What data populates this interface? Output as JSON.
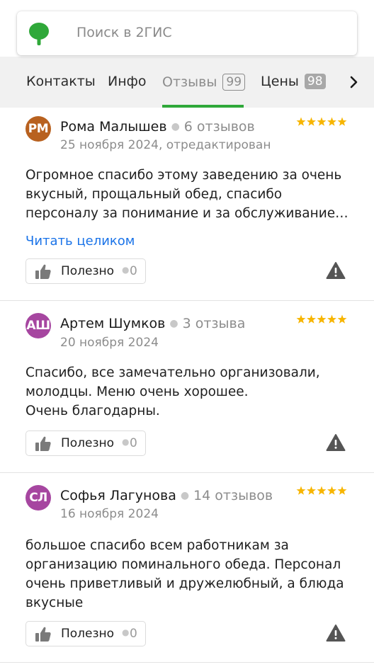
{
  "search": {
    "placeholder": "Поиск в 2ГИС",
    "logo_icon": "2gis-logo-icon",
    "brand_color": "#2fa839"
  },
  "tabs": [
    {
      "label": "Контакты"
    },
    {
      "label": "Инфо"
    },
    {
      "label": "Отзывы",
      "count": "99",
      "active": true
    },
    {
      "label": "Цены",
      "count": "98"
    }
  ],
  "tabs_more_icon": "chevron-right-icon",
  "reviews": [
    {
      "initials": "РМ",
      "avatar_color": "#b8611f",
      "author": "Рома Малышев",
      "review_count": "6 отзывов",
      "date": "25 ноября 2024, отредактирован",
      "rating": 5,
      "text": "Огромное спасибо этому заведению за очень вкусный, прощальный обед, спасибо персоналу за понимание и за обслуживание…",
      "read_more": "Читать целиком",
      "useful_label": "Полезно",
      "useful_count": "0"
    },
    {
      "initials": "АШ",
      "avatar_color": "#a646a0",
      "author": "Артем Шумков",
      "review_count": "3 отзыва",
      "date": "20 ноября 2024",
      "rating": 5,
      "text": "Спасибо, все замечательно организовали, молодцы. Меню очень хорошее.\nОчень благодарны.",
      "useful_label": "Полезно",
      "useful_count": "0"
    },
    {
      "initials": "СЛ",
      "avatar_color": "#a646a0",
      "author": "Софья Лагунова",
      "review_count": "14 отзывов",
      "date": "16 ноября 2024",
      "rating": 5,
      "text": "большое спасибо всем работникам за организацию поминального обеда. Персонал очень приветливый и дружелюбный, а блюда вкусные",
      "useful_label": "Полезно",
      "useful_count": "0"
    }
  ],
  "colors": {
    "star": "#f7b500",
    "link": "#1a73e8",
    "active_tab_underline": "#2fa839"
  }
}
